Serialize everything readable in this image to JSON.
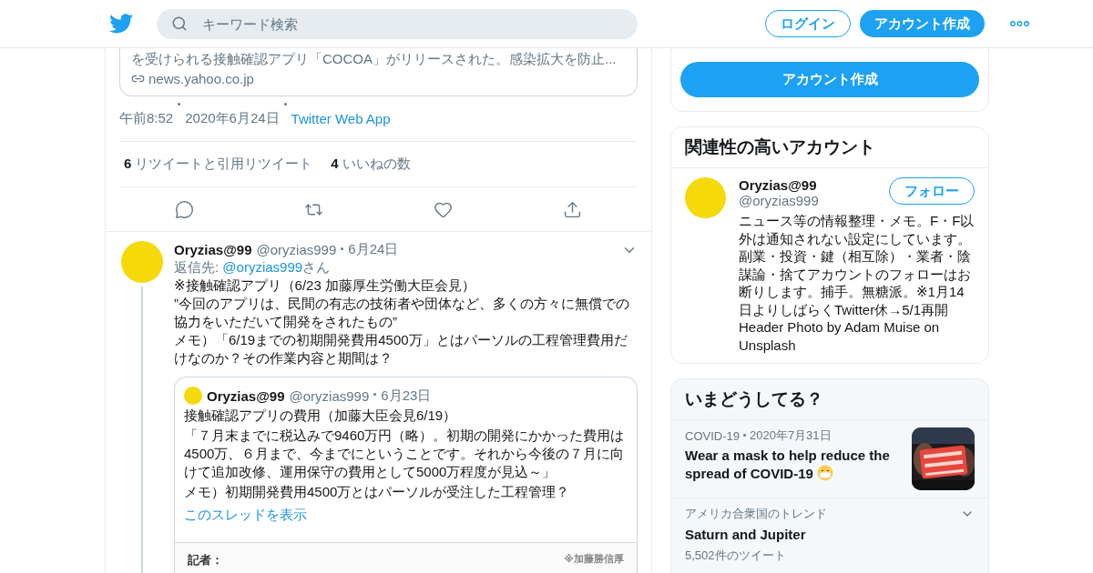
{
  "header": {
    "search_placeholder": "キーワード検索",
    "login": "ログイン",
    "signup": "アカウント作成"
  },
  "main_tweet": {
    "link_card": {
      "description": "を受けられる接触確認アプリ「COCOA」がリリースされた。感染拡大を防止...",
      "domain": "news.yahoo.co.jp"
    },
    "meta": {
      "time": "午前8:52",
      "date": "2020年6月24日",
      "source": "Twitter Web App"
    },
    "stats": [
      {
        "count": "6",
        "label": "リツイートと引用リツイート"
      },
      {
        "count": "4",
        "label": "いいねの数"
      }
    ]
  },
  "reply_tweet": {
    "name": "Oryzias@99",
    "handle": "@oryzias999",
    "date": "6月24日",
    "reply_prefix": "返信先: ",
    "reply_to": "@oryzias999",
    "reply_suffix": "さん",
    "lines": [
      "※接触確認アプリ（6/23 加藤厚生労働大臣会見）",
      "”今回のアプリは、民間の有志の技術者や団体など、多くの方々に無償での協力をいただいて開発をされたもの”",
      "メモ）「6/19までの初期開発費用4500万」とはパーソルの工程管理費用だけなのか？その作業内容と期間は？"
    ],
    "quote": {
      "name": "Oryzias@99",
      "handle": "@oryzias999",
      "date": "6月23日",
      "lines": [
        "接触確認アプリの費用（加藤大臣会見6/19）",
        "「７月末までに税込みで9460万円（略）。初期の開発にかかった費用は4500万、６月まで、今までにということです。それから今後の７月に向けて追加改修、運用保守の費用として5000万程度が見込～」",
        "メモ）初期開発費用4500万とはパーソルが受注した工程管理？"
      ],
      "show_thread": "このスレッドを表示",
      "image": {
        "heading": "記者：",
        "note": "※加藤勝信厚"
      }
    }
  },
  "sidebar": {
    "signup_button": "アカウント作成",
    "related": {
      "title": "関連性の高いアカウント",
      "accounts": [
        {
          "name": "Oryzias@99",
          "handle": "@oryzias999",
          "follow": "フォロー",
          "bio": "ニュース等の情報整理・メモ。F・F以外は通知されない設定にしています。副業・投資・鍵（相互除）・業者・陰謀論・捨てアカウントのフォローはお断りします。捕手。無糖派。※1月14日よりしばらくTwitter休→5/1再開\nHeader Photo by Adam Muise on Unsplash"
        }
      ]
    },
    "trends": {
      "title": "いまどうしてる？",
      "items": [
        {
          "kind": "event",
          "context": "COVID-19",
          "date": "2020年7月31日",
          "title": "Wear a mask to help reduce the spread of COVID-19"
        },
        {
          "kind": "trend",
          "context": "アメリカ合衆国のトレンド",
          "title": "Saturn and Jupiter",
          "count": "5,502件のツイート"
        }
      ]
    }
  }
}
